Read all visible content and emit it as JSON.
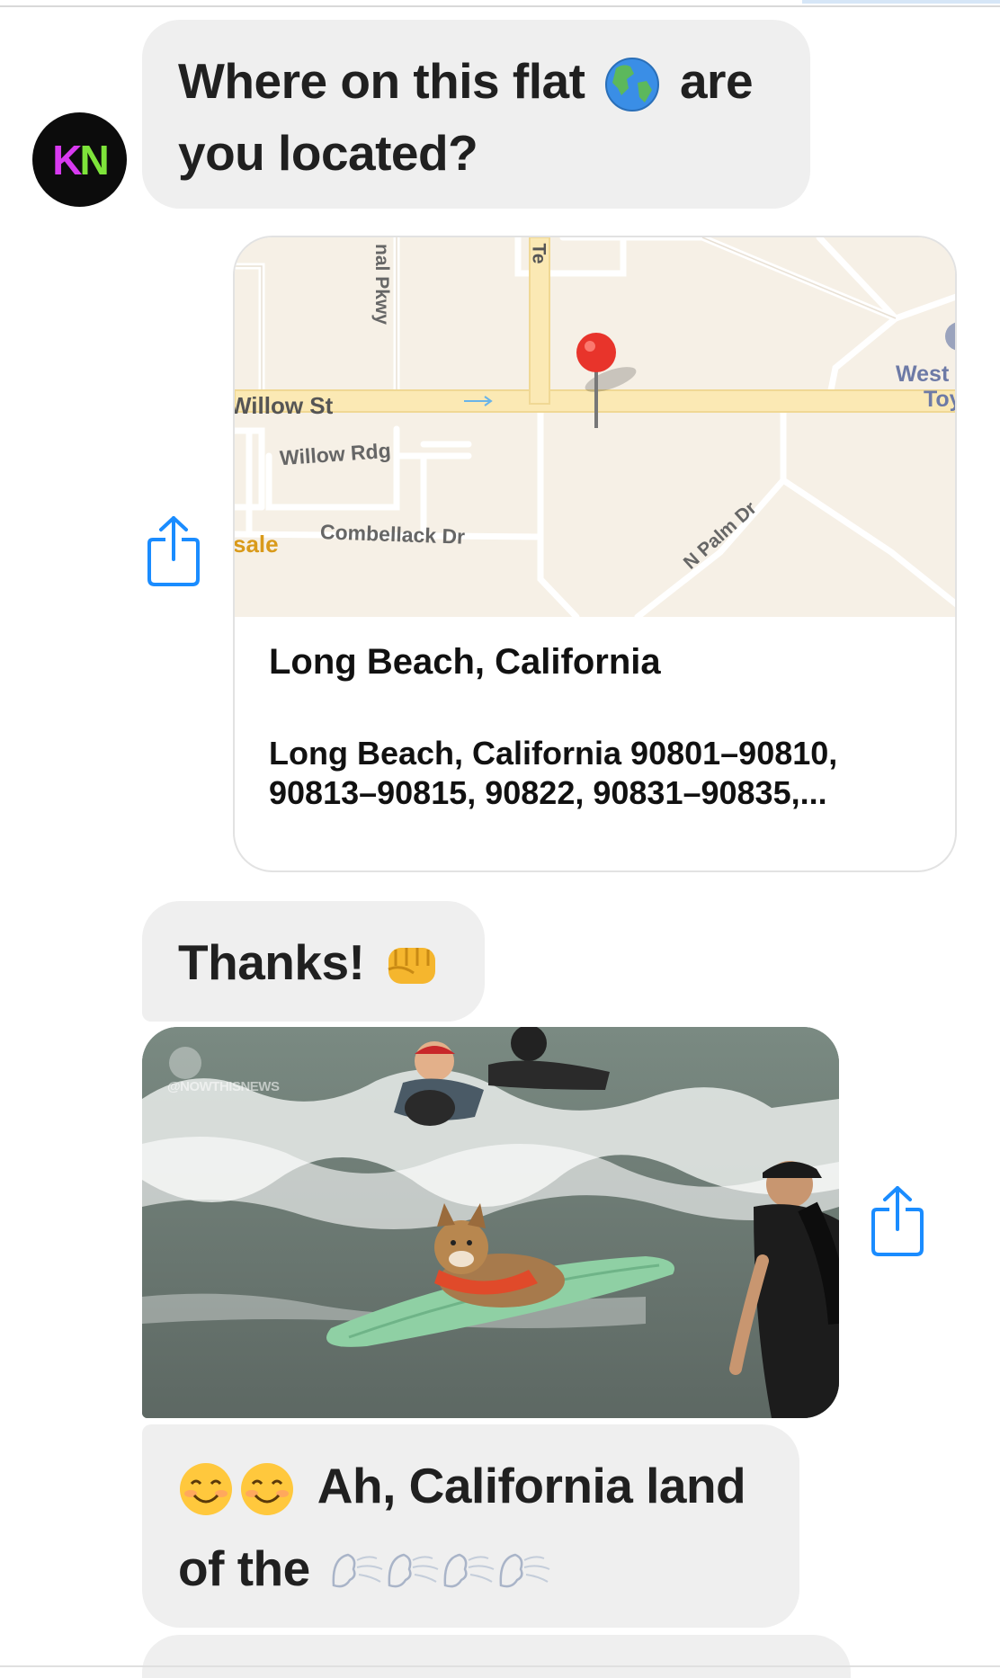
{
  "messages": {
    "question": {
      "line1_before": "Where on this flat",
      "line1_after": "are",
      "line2": "you located?",
      "emoji": "globe-americas"
    },
    "avatar": {
      "k": "K",
      "n": "N"
    },
    "map": {
      "streets": {
        "willow_st": "Willow St",
        "willow_rdg": "Willow Rdg",
        "combellack": "Combellack Dr",
        "palm": "N Palm Dr",
        "pkwy": "nal Pkwy",
        "te": "Te",
        "sale": "sale",
        "west": "West",
        "toy": "Toy"
      },
      "title": "Long Beach, California",
      "subtitle_line1": "Long Beach, California 90801–90810,",
      "subtitle_line2": "90813–90815, 90822, 90831–90835,..."
    },
    "thanks": {
      "text": "Thanks!",
      "emoji": "oncoming-fist"
    },
    "gif": {
      "watermark": "@NOWTHISNEWS"
    },
    "reply": {
      "line1": "Ah, California land",
      "line2": "of the",
      "emojis_line1": "smiling-face x2",
      "emojis_line2": "wind-face x4"
    }
  },
  "colors": {
    "bubble": "#efefef",
    "share_icon": "#1a8cff",
    "pin": "#e8342b"
  }
}
